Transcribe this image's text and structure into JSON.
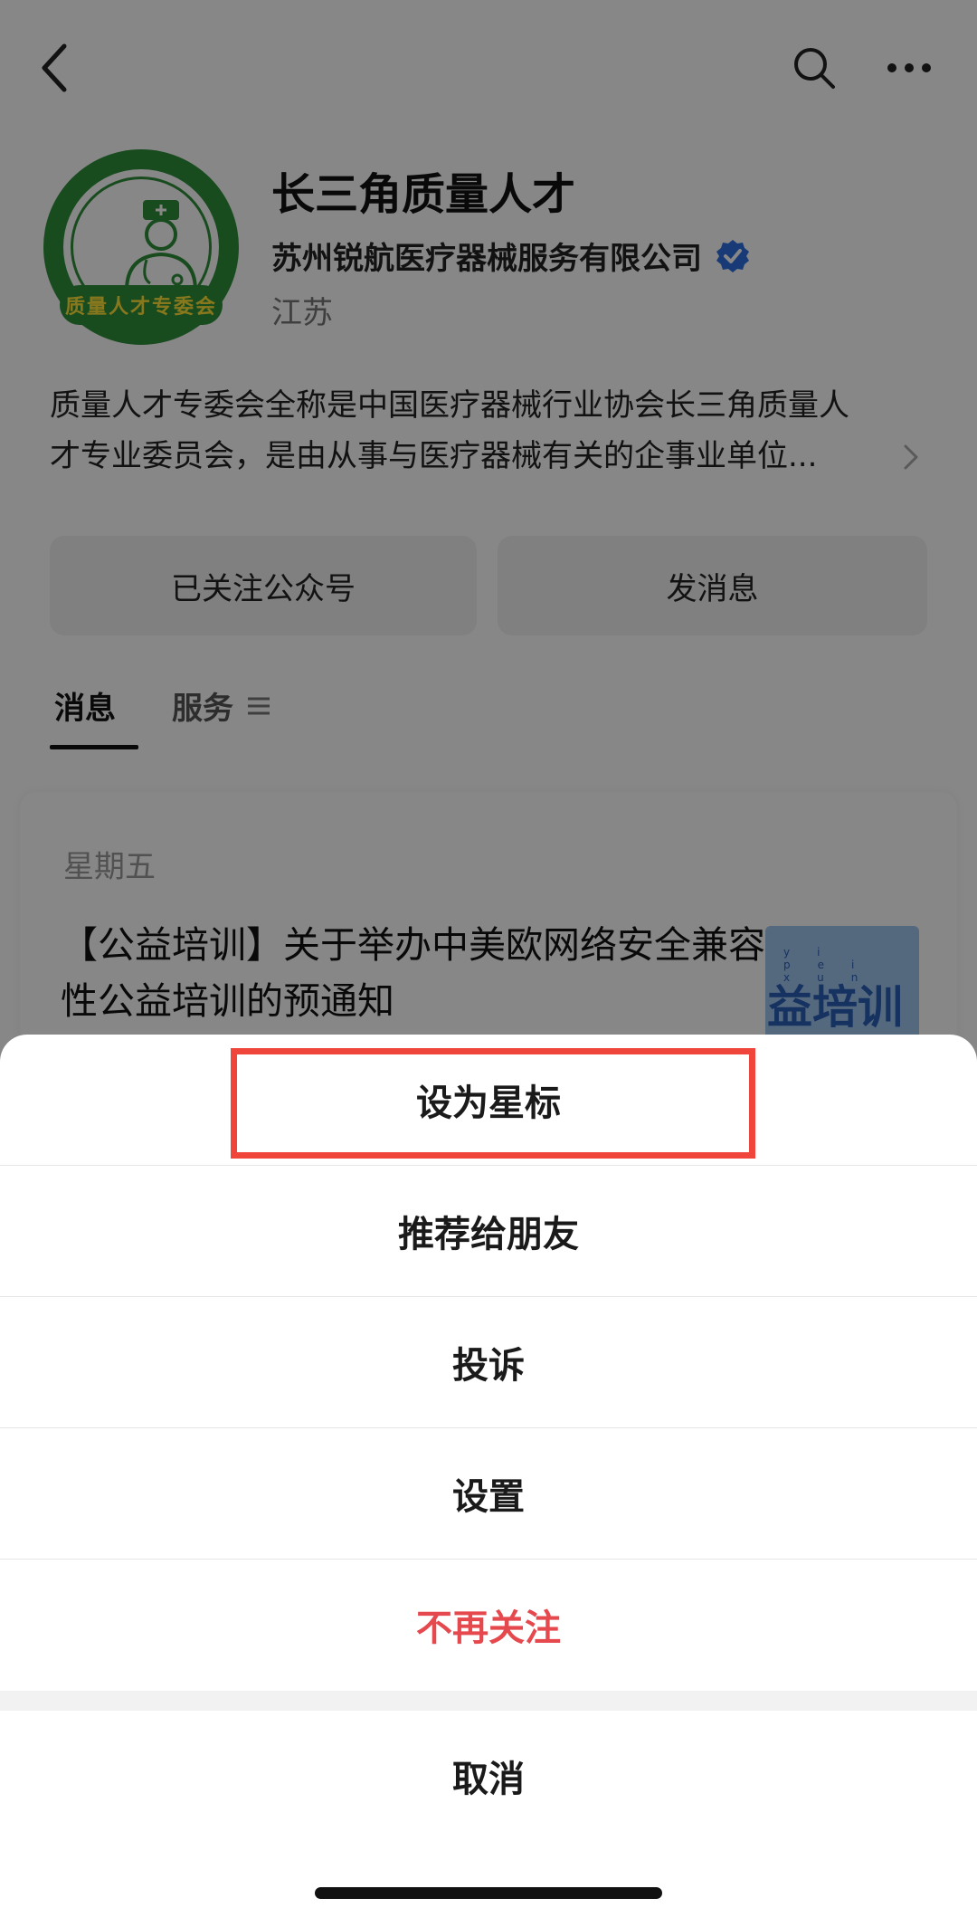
{
  "header": {
    "back_icon": "back-chevron-icon",
    "search_icon": "search-icon",
    "more_icon": "more-dots-icon"
  },
  "profile": {
    "avatar_banner": "质量人才专委会",
    "name": "长三角质量人才",
    "company": "苏州锐航医疗器械服务有限公司",
    "region": "江苏",
    "description_line1": "质量人才专委会全称是中国医疗器械行业协会长三角质量人",
    "description_line2": "才专业委员会，是由从事与医疗器械有关的企事业单位...",
    "verified_color": "#2f6fe0",
    "avatar_color": "#2f8f3a"
  },
  "actions": {
    "follow_label": "已关注公众号",
    "message_label": "发消息"
  },
  "tabs": {
    "messages": "消息",
    "services": "服务"
  },
  "article": {
    "day": "星期五",
    "title": "【公益培训】关于举办中美欧网络安全兼容性公益培训的预通知",
    "thumb_text": "益培训",
    "thumb_pinyin": "yi pei xun"
  },
  "sheet": {
    "star": "设为星标",
    "recommend": "推荐给朋友",
    "complain": "投诉",
    "settings": "设置",
    "unfollow": "不再关注",
    "cancel": "取消",
    "highlight_color": "#f0453a",
    "danger_color": "#e5484d"
  }
}
